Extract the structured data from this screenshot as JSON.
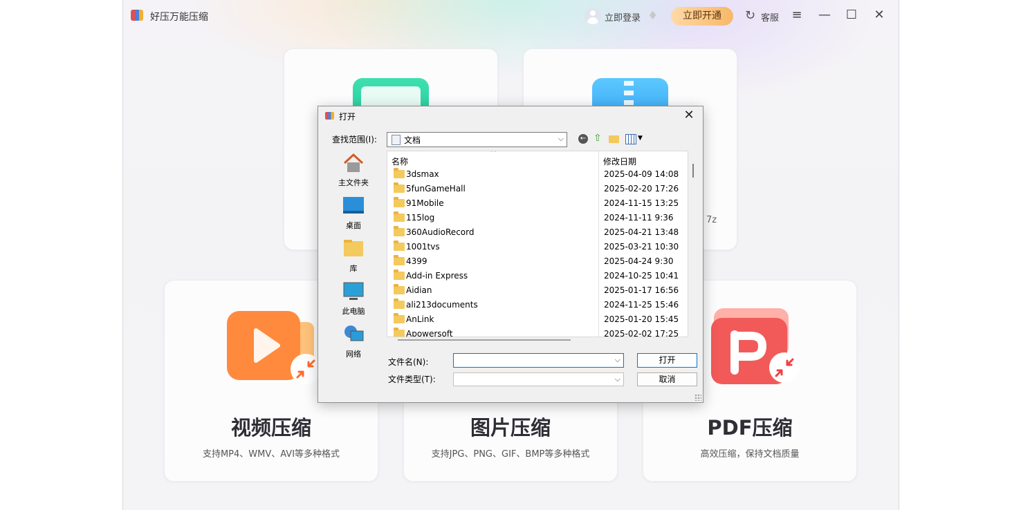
{
  "app": {
    "title": "好压万能压缩",
    "login_label": "立即登录",
    "vip_label": "立即开通",
    "service_label": "客服"
  },
  "cards": {
    "top_right_hint": "7z",
    "video": {
      "title": "视频压缩",
      "desc": "支持MP4、WMV、AVI等多种格式"
    },
    "image": {
      "title": "图片压缩",
      "desc": "支持JPG、PNG、GIF、BMP等多种格式"
    },
    "pdf": {
      "title": "PDF压缩",
      "desc": "高效压缩，保持文档质量"
    }
  },
  "dialog": {
    "title": "打开",
    "lookin_label": "查找范围(I):",
    "lookin_value": "文档",
    "places": [
      "主文件夹",
      "桌面",
      "库",
      "此电脑",
      "网络"
    ],
    "columns": {
      "name": "名称",
      "date": "修改日期"
    },
    "files": [
      {
        "name": "3dsmax",
        "date": "2025-04-09 14:08"
      },
      {
        "name": "5funGameHall",
        "date": "2025-02-20 17:26"
      },
      {
        "name": "91Mobile",
        "date": "2024-11-15 13:25"
      },
      {
        "name": "115log",
        "date": "2024-11-11 9:36"
      },
      {
        "name": "360AudioRecord",
        "date": "2025-04-21 13:48"
      },
      {
        "name": "1001tvs",
        "date": "2025-03-21 10:30"
      },
      {
        "name": "4399",
        "date": "2025-04-24 9:30"
      },
      {
        "name": "Add-in Express",
        "date": "2024-10-25 10:41"
      },
      {
        "name": "Aidian",
        "date": "2025-01-17 16:56"
      },
      {
        "name": "ali213documents",
        "date": "2024-11-25 15:46"
      },
      {
        "name": "AnLink",
        "date": "2025-01-20 15:45"
      },
      {
        "name": "Apowersoft",
        "date": "2025-02-02 17:25"
      }
    ],
    "filename_label": "文件名(N):",
    "filename_value": "",
    "filetype_label": "文件类型(T):",
    "filetype_value": "",
    "open_label": "打开",
    "cancel_label": "取消"
  },
  "colors": {
    "accent_vip": "#f7b868",
    "video": "#ff8a3d",
    "pdf": "#f25a5a",
    "green": "#1ac292",
    "blue": "#2a9cf0"
  }
}
